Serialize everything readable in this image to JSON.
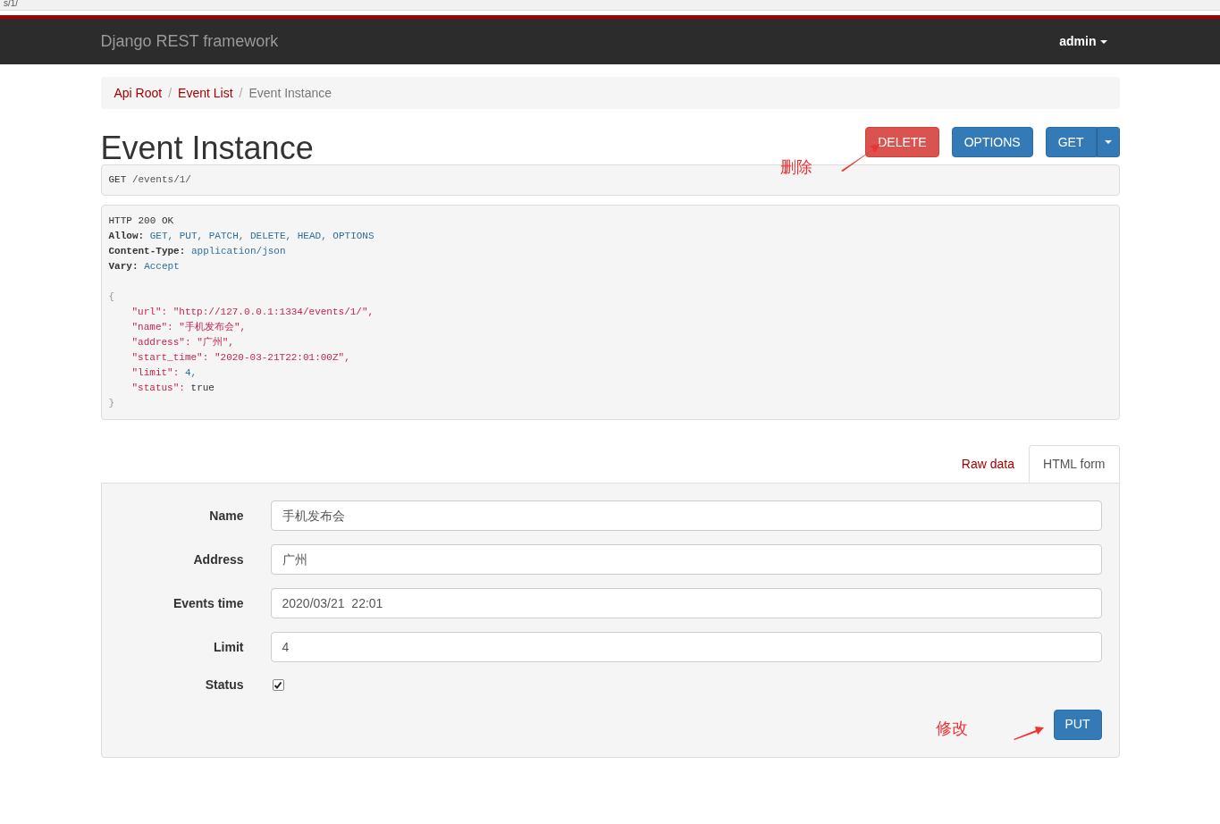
{
  "browser_strip": {
    "text": "s/1/"
  },
  "navbar": {
    "brand": "Django REST framework",
    "user": "admin"
  },
  "breadcrumb_separator": "/",
  "breadcrumbs": [
    {
      "label": "Api Root",
      "selected": false
    },
    {
      "label": "Event List",
      "selected": false
    },
    {
      "label": "Event Instance",
      "selected": true
    }
  ],
  "page_title": "Event Instance",
  "actions": [
    {
      "label": "DELETE",
      "kind": "danger",
      "dropdown": false
    },
    {
      "label": "OPTIONS",
      "kind": "primary",
      "dropdown": false
    },
    {
      "label": "GET",
      "kind": "primary",
      "dropdown": true
    }
  ],
  "request": {
    "method": "GET",
    "path": "/events/1/"
  },
  "response": {
    "status_line": "HTTP 200 OK",
    "headers": [
      {
        "name": "Allow:",
        "value": "GET, PUT, PATCH, DELETE, HEAD, OPTIONS"
      },
      {
        "name": "Content-Type:",
        "value": "application/json"
      },
      {
        "name": "Vary:",
        "value": "Accept"
      }
    ],
    "open_brace": "{",
    "body": [
      {
        "key": "\"url\":",
        "value": "\"http://127.0.0.1:1334/events/1/\",",
        "kind": "string"
      },
      {
        "key": "\"name\":",
        "value": "\"手机发布会\",",
        "kind": "string"
      },
      {
        "key": "\"address\":",
        "value": "\"广州\",",
        "kind": "string"
      },
      {
        "key": "\"start_time\":",
        "value": "\"2020-03-21T22:01:00Z\",",
        "kind": "string"
      },
      {
        "key": "\"limit\":",
        "value": "4,",
        "kind": "number"
      },
      {
        "key": "\"status\":",
        "value": "true",
        "kind": "literal"
      }
    ],
    "close_brace": "}"
  },
  "form_tabs": [
    {
      "label": "Raw data",
      "selected": false
    },
    {
      "label": "HTML form",
      "selected": true
    }
  ],
  "form": {
    "fields": [
      {
        "label": "Name",
        "kind": "text",
        "value": "手机发布会"
      },
      {
        "label": "Address",
        "kind": "text",
        "value": "广州"
      },
      {
        "label": "Events time",
        "kind": "text",
        "value": "2020/03/21  22:01"
      },
      {
        "label": "Limit",
        "kind": "text",
        "value": "4"
      },
      {
        "label": "Status",
        "kind": "checkbox",
        "checked": true
      }
    ],
    "submit": "PUT"
  },
  "annotations": [
    {
      "text": "删除"
    },
    {
      "text": "修改"
    }
  ]
}
